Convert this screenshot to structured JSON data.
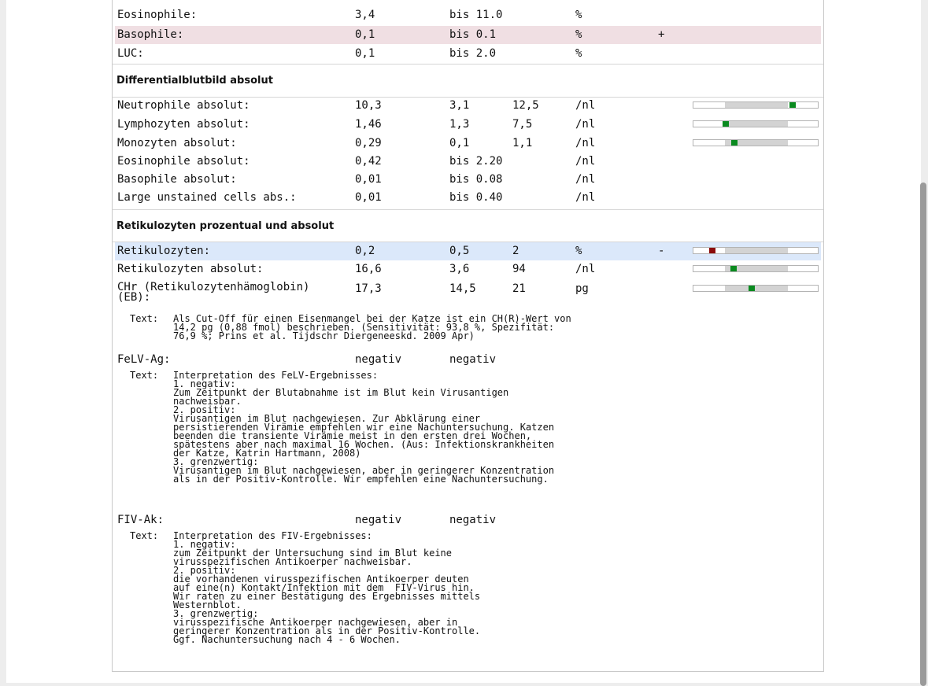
{
  "rows_top": [
    {
      "name": "Eosinophile:",
      "value": "3,4",
      "ref": "bis 11.0",
      "unit": "%",
      "flag": ""
    },
    {
      "name": "Basophile:",
      "value": "0,1",
      "ref": "bis 0.1",
      "unit": "%",
      "flag": "+"
    },
    {
      "name": "LUC:",
      "value": "0,1",
      "ref": "bis 2.0",
      "unit": "%",
      "flag": ""
    }
  ],
  "section_diff": {
    "title": "Differentialblutbild absolut",
    "rows": [
      {
        "name": "Neutrophile absolut:",
        "value": "10,3",
        "lo": "3,1",
        "hi": "12,5",
        "unit": "/nl",
        "pos": 0.8
      },
      {
        "name": "Lymphozyten absolut:",
        "value": "1,46",
        "lo": "1,3",
        "hi": "7,5",
        "unit": "/nl",
        "pos": 0.26
      },
      {
        "name": "Monozyten absolut:",
        "value": "0,29",
        "lo": "0,1",
        "hi": "1,1",
        "unit": "/nl",
        "pos": 0.33
      }
    ],
    "rows_ref": [
      {
        "name": "Eosinophile absolut:",
        "value": "0,42",
        "ref": "bis 2.20",
        "unit": "/nl"
      },
      {
        "name": "Basophile absolut:",
        "value": "0,01",
        "ref": "bis 0.08",
        "unit": "/nl"
      },
      {
        "name": "Large unstained cells abs.:",
        "value": "0,01",
        "ref": "bis 0.40",
        "unit": "/nl"
      }
    ]
  },
  "section_retic": {
    "title": "Retikulozyten prozentual und absolut",
    "rows": [
      {
        "name": "Retikulozyten:",
        "value": "0,2",
        "lo": "0,5",
        "hi": "2",
        "unit": "%",
        "flag": "-",
        "pos": 0.15
      },
      {
        "name": "Retikulozyten absolut:",
        "value": "16,6",
        "lo": "3,6",
        "hi": "94",
        "unit": "/nl",
        "flag": "",
        "pos": 0.32
      },
      {
        "name": "CHr (Retikulozytenhämoglobin)\n(EB):",
        "value": "17,3",
        "lo": "14,5",
        "hi": "21",
        "unit": "pg",
        "flag": "",
        "pos": 0.47
      }
    ],
    "note_label": "Text:",
    "note": "Als Cut-Off für einen Eisenmangel bei der Katze ist ein CH(R)-Wert von\n14,2 pg (0,88 fmol) beschrieben. (Sensitivität: 93,8 %, Spezifität:\n76,9 %; Prins et al. Tijdschr Diergeneeskd. 2009 Apr)"
  },
  "felv": {
    "name": "FeLV-Ag:",
    "value": "negativ",
    "ref": "negativ",
    "note_label": "Text:",
    "note": "Interpretation des FeLV-Ergebnisses:\n1. negativ:\nZum Zeitpunkt der Blutabnahme ist im Blut kein Virusantigen\nnachweisbar.\n2. positiv:\nVirusantigen im Blut nachgewiesen. Zur Abklärung einer\npersistierenden Virämie empfehlen wir eine Nachuntersuchung. Katzen\nbeenden die transiente Virämie meist in den ersten drei Wochen,\nspätestens aber nach maximal 16 Wochen. (Aus: Infektionskrankheiten\nder Katze, Katrin Hartmann, 2008)\n3. grenzwertig:\nVirusantigen im Blut nachgewiesen, aber in geringerer Konzentration\nals in der Positiv-Kontrolle. Wir empfehlen eine Nachuntersuchung."
  },
  "fiv": {
    "name": "FIV-Ak:",
    "value": "negativ",
    "ref": "negativ",
    "note_label": "Text:",
    "note": "Interpretation des FIV-Ergebnisses:\n1. negativ:\nzum Zeitpunkt der Untersuchung sind im Blut keine\nvirusspezifischen Antikoerper nachweisbar.\n2. positiv:\ndie vorhandenen virusspezifischen Antikoerper deuten\nauf eine(n) Kontakt/Infektion mit dem  FIV-Virus hin.\nWir raten zu einer Bestätigung des Ergebnisses mittels\nWesternblot.\n3. grenzwertig:\nvirusspezifische Antikoerper nachgewiesen, aber in\ngeringerer Konzentration als in der Positiv-Kontrolle.\nGgf. Nachuntersuchung nach 4 - 6 Wochen."
  },
  "colors": {
    "normal": "#0a8a1f",
    "low": "#8b0c0c",
    "highlight_high": "#f0dfe3",
    "highlight_low": "#dbe8fa"
  }
}
